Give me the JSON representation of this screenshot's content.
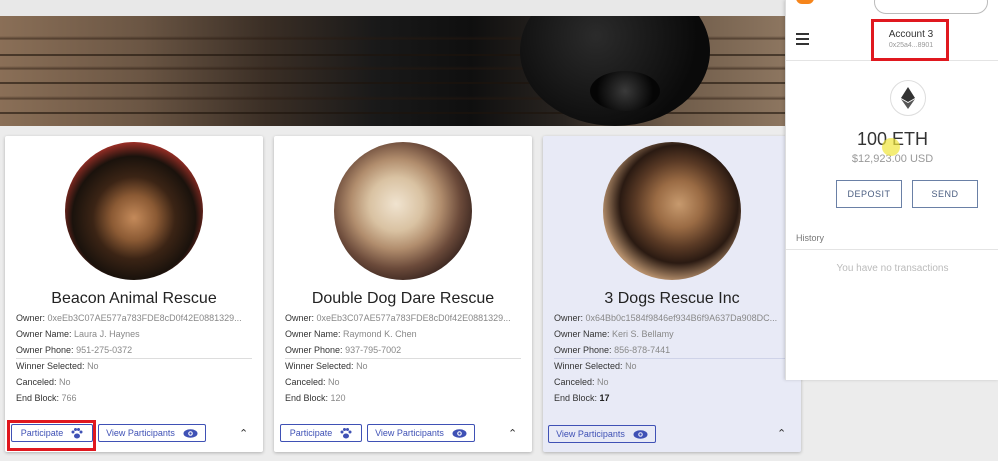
{
  "cards": [
    {
      "title": "Beacon Animal Rescue",
      "owner_label": "Owner:",
      "owner": "0xeEb3C07AE577a783FDE8cD0f42E0881329...",
      "owner_name_label": "Owner Name:",
      "owner_name": "Laura J. Haynes",
      "owner_phone_label": "Owner Phone:",
      "owner_phone": "951-275-0372",
      "winner_label": "Winner Selected:",
      "winner": "No",
      "canceled_label": "Canceled:",
      "canceled": "No",
      "end_block_label": "End Block:",
      "end_block": "766",
      "participate_label": "Participate",
      "view_label": "View Participants"
    },
    {
      "title": "Double Dog Dare Rescue",
      "owner_label": "Owner:",
      "owner": "0xeEb3C07AE577a783FDE8cD0f42E0881329...",
      "owner_name_label": "Owner Name:",
      "owner_name": "Raymond K. Chen",
      "owner_phone_label": "Owner Phone:",
      "owner_phone": "937-795-7002",
      "winner_label": "Winner Selected:",
      "winner": "No",
      "canceled_label": "Canceled:",
      "canceled": "No",
      "end_block_label": "End Block:",
      "end_block": "120",
      "participate_label": "Participate",
      "view_label": "View Participants"
    },
    {
      "title": "3 Dogs Rescue Inc",
      "owner_label": "Owner:",
      "owner": "0x64Bb0c1584f9846ef934B6f9A637Da908DC...",
      "owner_name_label": "Owner Name:",
      "owner_name": "Keri S. Bellamy",
      "owner_phone_label": "Owner Phone:",
      "owner_phone": "856-878-7441",
      "winner_label": "Winner Selected:",
      "winner": "No",
      "canceled_label": "Canceled:",
      "canceled": "No",
      "end_block_label": "End Block:",
      "end_block": "17",
      "view_label": "View Participants"
    }
  ],
  "wallet": {
    "account_name": "Account 3",
    "account_address": "0x25a4...8901",
    "balance": "100 ETH",
    "balance_usd": "$12,923.00 USD",
    "deposit_label": "DEPOSIT",
    "send_label": "SEND",
    "history_label": "History",
    "no_tx_text": "You have no transactions"
  },
  "colors": {
    "accent": "#3f51b5",
    "highlight": "#e0181f",
    "selected_card": "#e8eaf6"
  },
  "icons": [
    "paw-icon",
    "eye-icon",
    "chevron-up-icon",
    "menu-icon",
    "ethereum-icon",
    "metamask-fox-icon"
  ]
}
